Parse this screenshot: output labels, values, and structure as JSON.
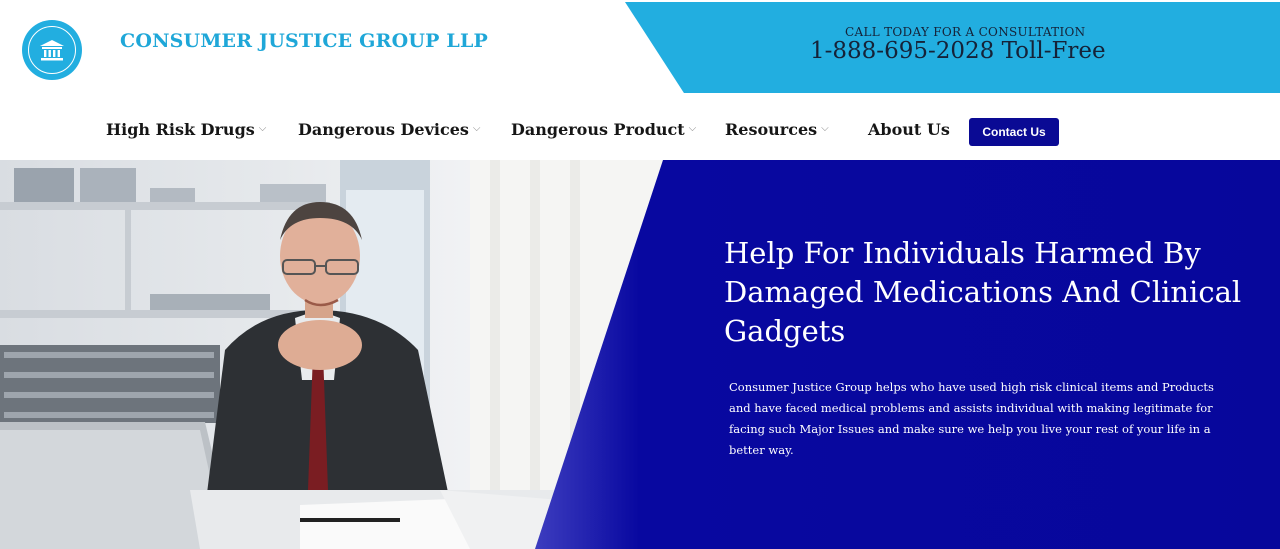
{
  "header": {
    "brand_name": "CONSUMER JUSTICE GROUP LLP",
    "logo_icon": "courthouse-icon",
    "cta_heading": "CALL TODAY FOR A CONSULTATION",
    "cta_phone": "1-888-695-2028 Toll-Free"
  },
  "nav": {
    "items": [
      {
        "label": "High Risk Drugs",
        "has_dropdown": true
      },
      {
        "label": "Dangerous Devices",
        "has_dropdown": true
      },
      {
        "label": "Dangerous Product",
        "has_dropdown": true
      },
      {
        "label": "Resources",
        "has_dropdown": true
      },
      {
        "label": "About Us",
        "has_dropdown": false
      }
    ],
    "chevron": "⌵",
    "contact_label": "Contact Us"
  },
  "hero": {
    "title": "Help For Individuals Harmed By Damaged Medications And Clinical Gadgets",
    "description": "Consumer Justice Group helps who have used  high risk clinical items and Products and have faced medical problems and assists individual with making legitimate for facing such Major Issues and make sure we help you live your rest of your life in a better way."
  },
  "colors": {
    "brand_cyan": "#22aee0",
    "brand_text": "#1fa7d8",
    "navy": "#0a0a94",
    "text_dark": "#161616"
  }
}
